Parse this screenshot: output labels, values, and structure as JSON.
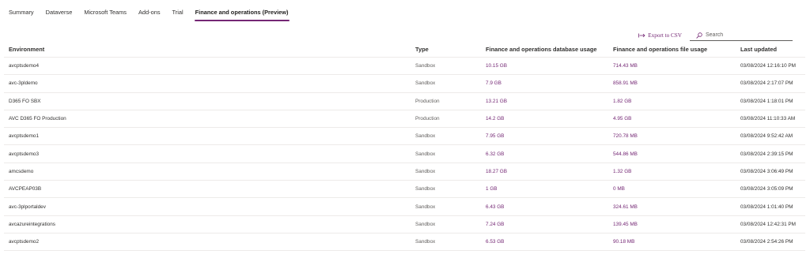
{
  "tabs": [
    {
      "label": "Summary",
      "active": false
    },
    {
      "label": "Dataverse",
      "active": false
    },
    {
      "label": "Microsoft Teams",
      "active": false
    },
    {
      "label": "Add-ons",
      "active": false
    },
    {
      "label": "Trial",
      "active": false
    },
    {
      "label": "Finance and operations (Preview)",
      "active": true
    }
  ],
  "toolbar": {
    "export_label": "Export to CSV",
    "export_icon": "export-arrow-icon",
    "search_icon": "search-icon",
    "search_placeholder": "Search",
    "search_value": ""
  },
  "colors": {
    "accent": "#742774",
    "text": "#323130",
    "muted": "#605e5c",
    "divider": "#edebe9"
  },
  "table": {
    "columns": [
      {
        "key": "environment",
        "label": "Environment"
      },
      {
        "key": "type",
        "label": "Type"
      },
      {
        "key": "db_usage",
        "label": "Finance and operations database usage"
      },
      {
        "key": "file_usage",
        "label": "Finance and operations file usage"
      },
      {
        "key": "last_updated",
        "label": "Last updated"
      }
    ],
    "rows": [
      {
        "environment": "avcptsdemo4",
        "type": "Sandbox",
        "db_usage": "10.15 GB",
        "file_usage": "714.43 MB",
        "last_updated": "03/08/2024 12:16:10 PM"
      },
      {
        "environment": "avc-3pldemo",
        "type": "Sandbox",
        "db_usage": "7.9 GB",
        "file_usage": "858.91 MB",
        "last_updated": "03/08/2024 2:17:07 PM"
      },
      {
        "environment": "D365 FO SBX",
        "type": "Production",
        "db_usage": "13.21 GB",
        "file_usage": "1.82 GB",
        "last_updated": "03/08/2024 1:18:01 PM"
      },
      {
        "environment": "AVC D365 FO Production",
        "type": "Production",
        "db_usage": "14.2 GB",
        "file_usage": "4.95 GB",
        "last_updated": "03/08/2024 11:10:33 AM"
      },
      {
        "environment": "avcptsdemo1",
        "type": "Sandbox",
        "db_usage": "7.95 GB",
        "file_usage": "720.78 MB",
        "last_updated": "03/08/2024 9:52:42 AM"
      },
      {
        "environment": "avcptsdemo3",
        "type": "Sandbox",
        "db_usage": "6.32 GB",
        "file_usage": "544.86 MB",
        "last_updated": "03/08/2024 2:39:15 PM"
      },
      {
        "environment": "amcsdemo",
        "type": "Sandbox",
        "db_usage": "18.27 GB",
        "file_usage": "1.32 GB",
        "last_updated": "03/08/2024 3:06:49 PM"
      },
      {
        "environment": "AVCPEAP03B",
        "type": "Sandbox",
        "db_usage": "1 GB",
        "file_usage": "0 MB",
        "last_updated": "03/08/2024 3:05:09 PM"
      },
      {
        "environment": "avc-3plportaldev",
        "type": "Sandbox",
        "db_usage": "6.43 GB",
        "file_usage": "324.61 MB",
        "last_updated": "03/08/2024 1:01:40 PM"
      },
      {
        "environment": "avcazureintegrations",
        "type": "Sandbox",
        "db_usage": "7.24 GB",
        "file_usage": "139.45 MB",
        "last_updated": "03/08/2024 12:42:31 PM"
      },
      {
        "environment": "avcptsdemo2",
        "type": "Sandbox",
        "db_usage": "6.53 GB",
        "file_usage": "90.18 MB",
        "last_updated": "03/08/2024 2:54:26 PM"
      }
    ]
  }
}
